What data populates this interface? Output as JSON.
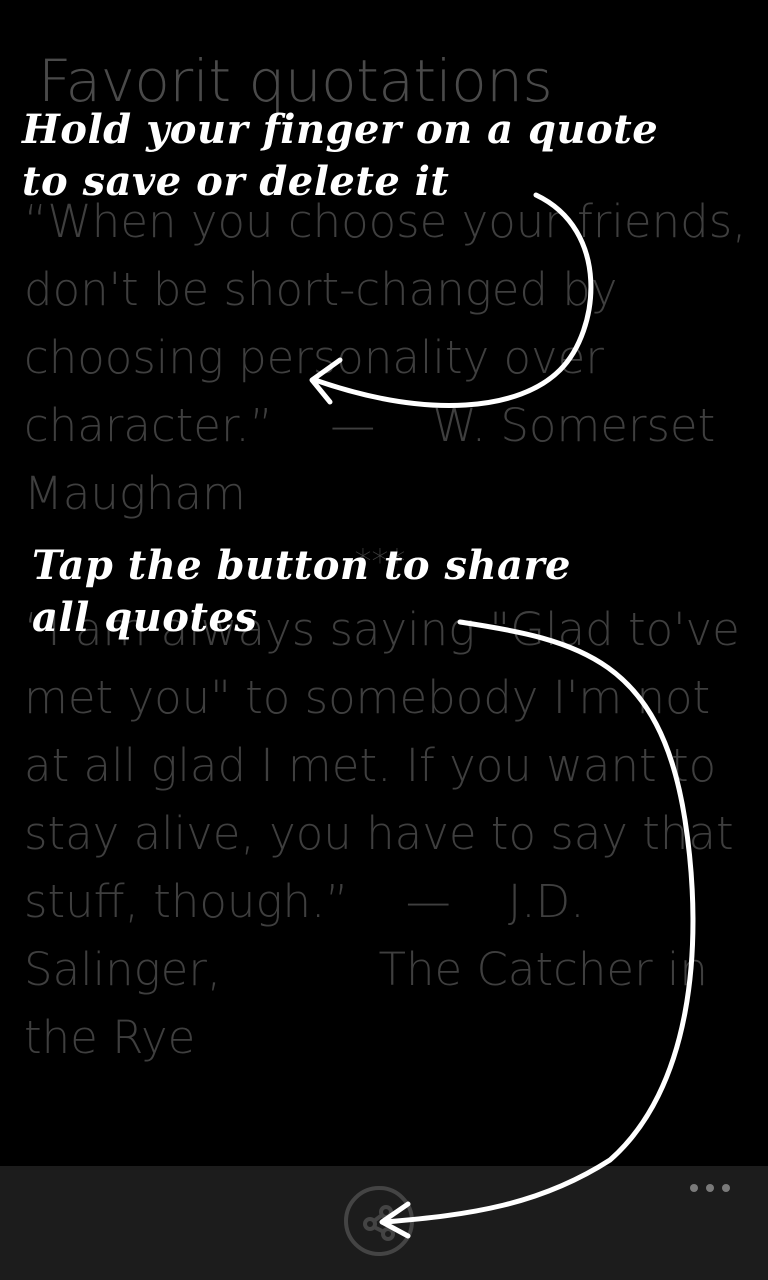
{
  "page": {
    "title": "Favorit quotations"
  },
  "quotes": [
    {
      "text": "“When you choose your friends, don't be short-changed by choosing personality over character.”    —    W. Somerset Maugham"
    },
    {
      "text": "“I am always saying \"Glad to've met you\" to somebody I'm not at all glad I met. If you want to stay alive, you have to say that stuff, though.”    —    J.D. Salinger,           The Catcher in the Rye"
    }
  ],
  "separator": "***",
  "hints": {
    "hold": [
      "Hold your finger on a quote",
      "to save or delete it"
    ],
    "tap": [
      "Tap the button to share",
      "all quotes"
    ]
  },
  "app_bar": {
    "share_icon": "share-icon",
    "more_icon": "more-dots-icon"
  },
  "colors": {
    "background": "#000000",
    "dim_text": "#3f3f3f",
    "app_bar": "#1c1c1c",
    "hint_text": "#ffffff"
  }
}
